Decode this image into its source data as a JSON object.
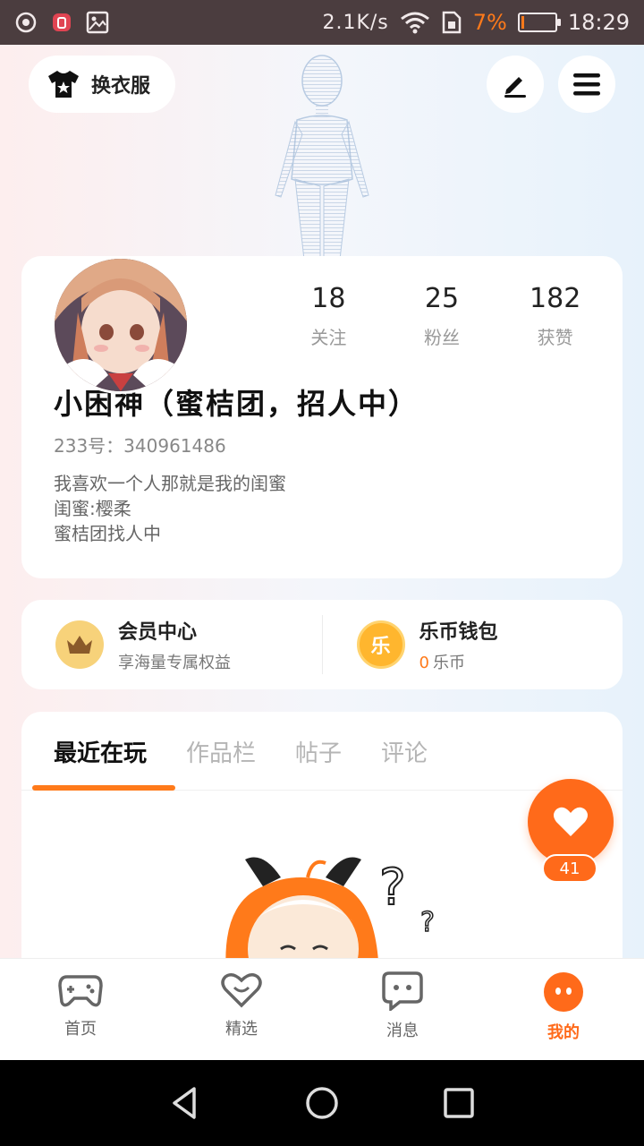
{
  "status_bar": {
    "network_speed": "2.1K/s",
    "battery_percent": "7%",
    "battery_level": 0.07,
    "time": "18:29",
    "left_icons": [
      "hotspot-icon",
      "notification-app-icon",
      "gallery-icon"
    ],
    "right_icons": [
      "wifi-icon",
      "sim-icon",
      "battery-icon"
    ]
  },
  "header": {
    "change_outfit_label": "换衣服",
    "change_outfit_icon": "tshirt-icon",
    "edit_icon": "pen-icon",
    "menu_icon": "menu-icon"
  },
  "profile": {
    "stats": [
      {
        "value": "18",
        "label": "关注"
      },
      {
        "value": "25",
        "label": "粉丝"
      },
      {
        "value": "182",
        "label": "获赞"
      }
    ],
    "nickname": "小困神（蜜桔团，招人中）",
    "uid": "233号：340961486",
    "bio": [
      "我喜欢一个人那就是我的闺蜜",
      "闺蜜:樱柔",
      "蜜桔团找人中"
    ]
  },
  "vip": {
    "member_title": "会员中心",
    "member_sub": "享海量专属权益",
    "wallet_title": "乐币钱包",
    "wallet_amount": "0",
    "wallet_unit": "乐币",
    "coin_char": "乐"
  },
  "tabs": [
    {
      "label": "最近在玩",
      "active": true
    },
    {
      "label": "作品栏",
      "active": false
    },
    {
      "label": "帖子",
      "active": false
    },
    {
      "label": "评论",
      "active": false
    }
  ],
  "fab": {
    "count": "41",
    "icon": "heart-icon"
  },
  "bottom_nav": [
    {
      "label": "首页",
      "icon": "gamepad-icon",
      "active": false
    },
    {
      "label": "精选",
      "icon": "heart-chat-icon",
      "active": false
    },
    {
      "label": "消息",
      "icon": "message-icon",
      "active": false
    },
    {
      "label": "我的",
      "icon": "profile-face-icon",
      "active": true
    }
  ],
  "colors": {
    "accent": "#ff6a1a",
    "status_bar_bg": "#4b3d3f"
  }
}
